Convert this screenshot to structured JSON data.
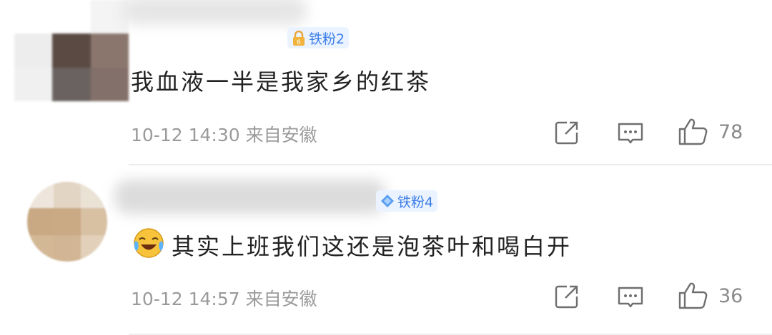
{
  "comments": [
    {
      "badge": "铁粉2",
      "text": "我血液一半是我家乡的红茶",
      "time": "10-12 14:30",
      "location": "来自安徽",
      "likes": "78"
    },
    {
      "badge": "铁粉4",
      "text": "其实上班我们这还是泡茶叶和喝白开",
      "time": "10-12 14:57",
      "location": "来自安徽",
      "likes": "36"
    }
  ],
  "icons": {
    "share": "share-icon",
    "reply": "comment-icon",
    "like": "thumbs-up-icon",
    "emoji": "laughing-crying-emoji"
  },
  "colors": {
    "badge_text": "#3d7ee8",
    "badge_bg": "#eaf3ff",
    "meta": "#9a9a9a",
    "icon": "#6f6f6f"
  }
}
